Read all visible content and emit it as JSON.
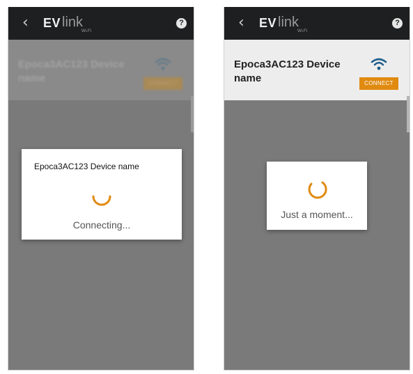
{
  "colors": {
    "topbar": "#1e1f20",
    "overlay": "#7a7a7a",
    "accent": "#e08a10",
    "wifi_blue": "#1f5f8b",
    "dialog_bg": "#ffffff"
  },
  "icons": {
    "back": "chevron-left-icon",
    "help": "question-mark-circle-icon",
    "wifi": "wifi-signal-icon",
    "spinner": "loading-spinner-icon"
  },
  "screens": [
    {
      "header": {
        "logo_ev": "EV",
        "logo_link": "link",
        "logo_sub": "Wi-Fi",
        "help_label": "?"
      },
      "device": {
        "name": "Epoca3AC123 Device name",
        "connect_label": "CONNECT"
      },
      "dialog": {
        "title": "Epoca3AC123 Device name",
        "status": "Connecting..."
      }
    },
    {
      "header": {
        "logo_ev": "EV",
        "logo_link": "link",
        "logo_sub": "Wi-Fi",
        "help_label": "?"
      },
      "device": {
        "name": "Epoca3AC123 Device name",
        "connect_label": "CONNECT"
      },
      "dialog": {
        "status": "Just a moment..."
      }
    }
  ]
}
